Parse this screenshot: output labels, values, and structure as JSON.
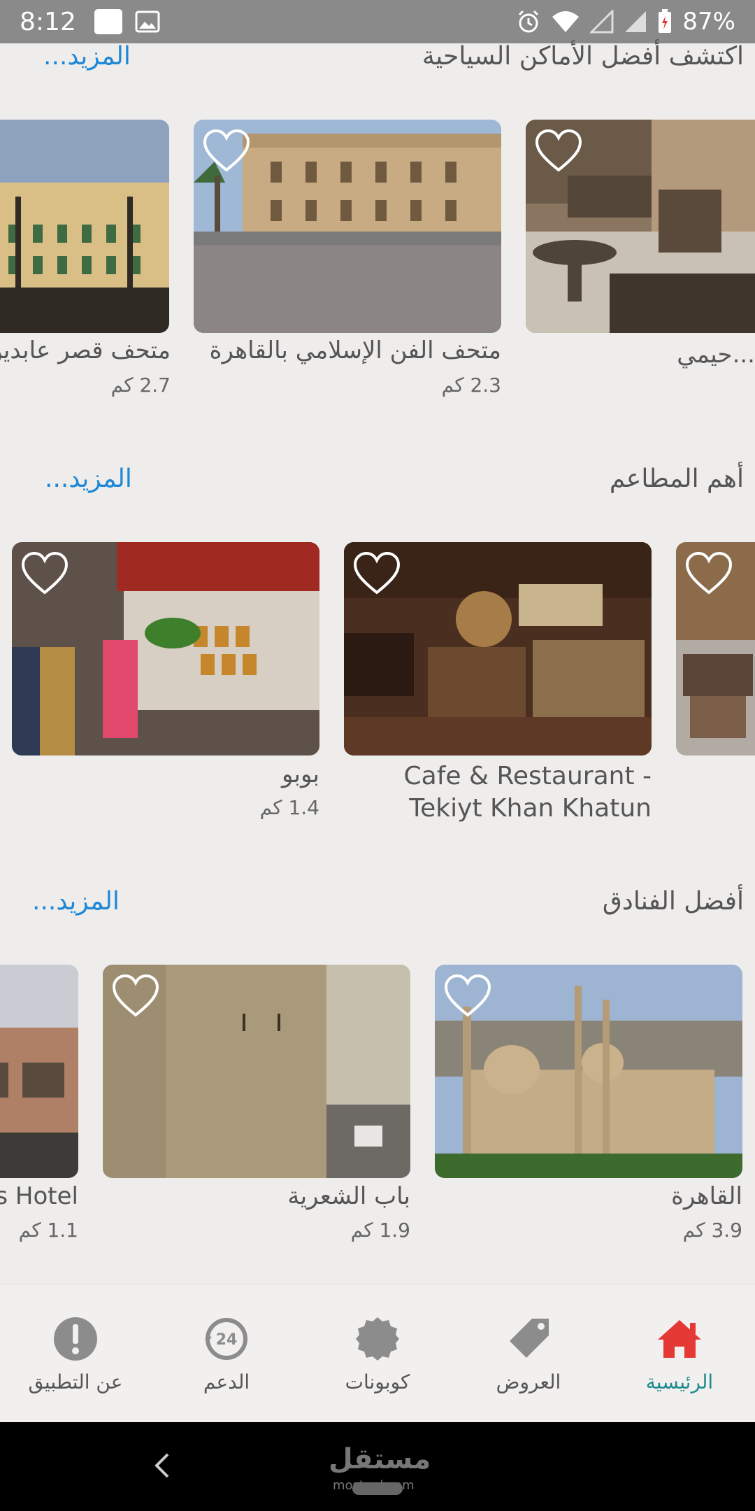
{
  "status_bar": {
    "time": "8:12",
    "battery": "87%"
  },
  "sections": [
    {
      "title": "اكتشف أفضل الأماكن السياحية",
      "more": "المزيد...",
      "cards": [
        {
          "title": "...حيمي",
          "distance": ""
        },
        {
          "title": "متحف الفن الإسلامي بالقاهرة",
          "distance": "2.3 كم"
        },
        {
          "title": "متحف قصر عابدين",
          "distance": "2.7 كم"
        }
      ]
    },
    {
      "title": "أهم المطاعم",
      "more": "المزيد...",
      "cards": [
        {
          "title": "",
          "distance": ""
        },
        {
          "title": "Cafe & Restaurant - Tekiyt Khan Khatun",
          "distance": ""
        },
        {
          "title": "بوبو",
          "distance": "1.4 كم"
        }
      ]
    },
    {
      "title": "أفضل الفنادق",
      "more": "المزيد...",
      "cards": [
        {
          "title": "القاهرة",
          "distance": "3.9 كم"
        },
        {
          "title": "باب الشعرية",
          "distance": "1.9 كم"
        },
        {
          "title": "s Hotel",
          "distance": "1.1 كم"
        }
      ]
    }
  ],
  "bottom_nav": [
    {
      "label": "الرئيسية",
      "icon": "home-icon",
      "active": true
    },
    {
      "label": "العروض",
      "icon": "tag-icon",
      "active": false
    },
    {
      "label": "كوبونات",
      "icon": "coupon-icon",
      "active": false
    },
    {
      "label": "الدعم",
      "icon": "support-24-icon",
      "active": false
    },
    {
      "label": "عن التطبيق",
      "icon": "info-icon",
      "active": false
    }
  ],
  "colors": {
    "accent": "#1f8b8e",
    "link": "#1e88d6",
    "home_icon": "#e53935",
    "background": "#efedec"
  },
  "watermark": {
    "main": "مستقل",
    "sub": "mostaql.com"
  }
}
